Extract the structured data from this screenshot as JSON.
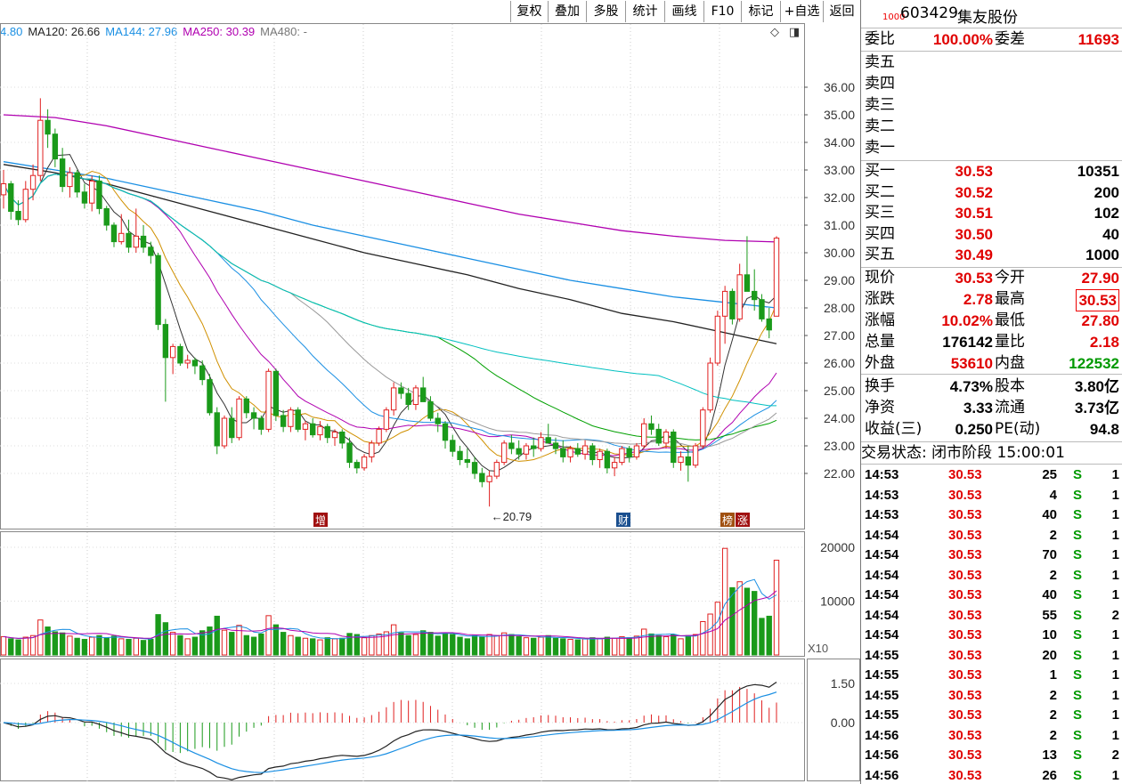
{
  "toolbar": {
    "buttons": [
      "复权",
      "叠加",
      "多股",
      "统计",
      "画线",
      "F10",
      "标记",
      "+自选",
      "返回"
    ]
  },
  "ma_legend": [
    {
      "label": "4.80",
      "color": "#1a8fe3"
    },
    {
      "label": "MA120: 26.66",
      "color": "#222222"
    },
    {
      "label": "MA144: 27.96",
      "color": "#1a8fe3"
    },
    {
      "label": "MA250: 30.39",
      "color": "#b000b0"
    },
    {
      "label": "MA480: -",
      "color": "#777777"
    }
  ],
  "chart_labels": {
    "low_marker": "←20.79",
    "event_tags": [
      {
        "text": "增",
        "color": "#a01010"
      },
      {
        "text": "财",
        "color": "#1a4f8f"
      },
      {
        "text": "榜",
        "color": "#a05010"
      },
      {
        "text": "涨",
        "color": "#a01010"
      }
    ],
    "volume_unit": "X10"
  },
  "chart_data": {
    "type": "candlestick",
    "price_axis": {
      "ticks": [
        "36.00",
        "35.00",
        "34.00",
        "33.00",
        "32.00",
        "31.00",
        "30.00",
        "29.00",
        "28.00",
        "27.00",
        "26.00",
        "25.00",
        "24.00",
        "23.00",
        "22.00"
      ],
      "range": [
        21.0,
        36.5
      ]
    },
    "volume_axis": {
      "ticks": [
        "20000",
        "10000"
      ],
      "range": [
        0,
        22000
      ]
    },
    "macd_axis": {
      "ticks": [
        "1.50",
        "0.00"
      ],
      "range": [
        -2.2,
        1.9
      ]
    },
    "candles": [
      [
        32.1,
        33.0,
        31.6,
        32.5,
        3400
      ],
      [
        32.5,
        32.6,
        31.2,
        31.5,
        3000
      ],
      [
        31.5,
        31.9,
        31.0,
        31.2,
        2800
      ],
      [
        31.2,
        32.6,
        31.1,
        32.3,
        3300
      ],
      [
        32.3,
        33.2,
        31.9,
        32.8,
        3600
      ],
      [
        32.8,
        35.6,
        32.6,
        34.8,
        6500
      ],
      [
        34.8,
        35.2,
        33.8,
        34.3,
        5200
      ],
      [
        34.3,
        34.5,
        33.1,
        33.4,
        4300
      ],
      [
        33.4,
        33.8,
        32.2,
        32.4,
        4100
      ],
      [
        32.4,
        33.1,
        32.0,
        32.9,
        3500
      ],
      [
        32.9,
        33.0,
        32.0,
        32.2,
        3100
      ],
      [
        32.2,
        32.5,
        31.6,
        31.8,
        2900
      ],
      [
        31.8,
        32.8,
        31.5,
        32.6,
        3300
      ],
      [
        32.6,
        32.8,
        31.4,
        31.6,
        3600
      ],
      [
        31.6,
        31.7,
        30.8,
        31.0,
        3200
      ],
      [
        31.0,
        31.1,
        30.2,
        30.4,
        3500
      ],
      [
        30.4,
        31.4,
        30.3,
        30.7,
        3000
      ],
      [
        30.7,
        31.2,
        30.0,
        30.2,
        2900
      ],
      [
        30.2,
        31.6,
        30.0,
        30.6,
        3100
      ],
      [
        30.6,
        31.0,
        30.0,
        30.2,
        2700
      ],
      [
        30.2,
        30.4,
        29.6,
        29.9,
        2900
      ],
      [
        29.9,
        30.0,
        27.2,
        27.4,
        7500
      ],
      [
        27.4,
        27.6,
        24.6,
        26.2,
        6000
      ],
      [
        26.2,
        26.7,
        25.6,
        26.6,
        4200
      ],
      [
        26.6,
        26.7,
        25.9,
        26.0,
        3600
      ],
      [
        26.0,
        26.3,
        25.8,
        26.1,
        3000
      ],
      [
        26.1,
        26.2,
        25.6,
        25.9,
        3300
      ],
      [
        25.9,
        26.1,
        25.2,
        25.4,
        4500
      ],
      [
        25.4,
        25.6,
        24.1,
        24.2,
        5200
      ],
      [
        24.2,
        24.4,
        22.7,
        23.0,
        7200
      ],
      [
        23.0,
        24.1,
        22.9,
        24.0,
        4600
      ],
      [
        24.0,
        24.4,
        23.1,
        23.3,
        4200
      ],
      [
        23.3,
        24.8,
        23.2,
        24.7,
        5500
      ],
      [
        24.7,
        24.8,
        24.0,
        24.2,
        3600
      ],
      [
        24.2,
        24.4,
        23.6,
        24.0,
        3300
      ],
      [
        24.0,
        24.1,
        23.4,
        23.6,
        3900
      ],
      [
        23.6,
        25.8,
        23.5,
        25.7,
        7300
      ],
      [
        25.7,
        25.8,
        23.9,
        24.1,
        5600
      ],
      [
        24.1,
        24.3,
        23.5,
        23.7,
        4200
      ],
      [
        23.7,
        24.4,
        23.5,
        24.3,
        3600
      ],
      [
        24.3,
        24.4,
        23.5,
        23.6,
        3300
      ],
      [
        23.6,
        23.9,
        23.2,
        23.8,
        3100
      ],
      [
        23.8,
        24.0,
        23.3,
        23.4,
        3000
      ],
      [
        23.4,
        23.9,
        23.2,
        23.7,
        2800
      ],
      [
        23.7,
        23.8,
        23.1,
        23.3,
        3200
      ],
      [
        23.3,
        23.6,
        23.0,
        23.5,
        3000
      ],
      [
        23.5,
        23.6,
        22.9,
        23.1,
        3100
      ],
      [
        23.1,
        23.3,
        22.2,
        22.4,
        4000
      ],
      [
        22.4,
        22.5,
        22.0,
        22.2,
        3800
      ],
      [
        22.2,
        22.7,
        22.1,
        22.6,
        3200
      ],
      [
        22.6,
        23.2,
        22.4,
        23.1,
        3600
      ],
      [
        23.1,
        23.7,
        23.0,
        23.6,
        3900
      ],
      [
        23.6,
        24.4,
        23.5,
        24.3,
        4300
      ],
      [
        24.3,
        25.3,
        24.1,
        25.1,
        5600
      ],
      [
        25.1,
        25.3,
        24.7,
        24.9,
        4100
      ],
      [
        24.9,
        25.1,
        24.3,
        24.5,
        3600
      ],
      [
        24.5,
        25.2,
        24.3,
        25.1,
        3800
      ],
      [
        25.1,
        25.5,
        24.6,
        24.6,
        4500
      ],
      [
        24.6,
        24.8,
        23.9,
        24.0,
        4200
      ],
      [
        24.0,
        24.2,
        23.5,
        23.8,
        3500
      ],
      [
        23.8,
        23.9,
        22.9,
        23.2,
        4000
      ],
      [
        23.2,
        23.4,
        22.6,
        22.8,
        3800
      ],
      [
        22.8,
        23.0,
        22.3,
        22.5,
        3300
      ],
      [
        22.5,
        22.9,
        22.2,
        22.4,
        3000
      ],
      [
        22.4,
        22.6,
        21.8,
        22.0,
        3600
      ],
      [
        22.0,
        22.2,
        21.5,
        21.7,
        3400
      ],
      [
        21.7,
        22.1,
        20.8,
        21.9,
        3800
      ],
      [
        21.9,
        22.5,
        21.8,
        22.4,
        3600
      ],
      [
        22.4,
        23.2,
        22.3,
        23.1,
        4100
      ],
      [
        23.1,
        23.4,
        22.7,
        22.9,
        3800
      ],
      [
        22.9,
        23.2,
        22.5,
        22.7,
        3400
      ],
      [
        22.7,
        23.1,
        22.5,
        23.0,
        3200
      ],
      [
        23.0,
        23.3,
        22.6,
        22.9,
        3100
      ],
      [
        22.9,
        23.5,
        22.8,
        23.3,
        3300
      ],
      [
        23.3,
        23.8,
        23.1,
        23.1,
        3600
      ],
      [
        23.1,
        23.3,
        22.7,
        22.9,
        3100
      ],
      [
        22.9,
        23.2,
        22.4,
        22.6,
        3000
      ],
      [
        22.6,
        23.0,
        22.4,
        22.9,
        2900
      ],
      [
        22.9,
        23.1,
        22.6,
        22.7,
        2800
      ],
      [
        22.7,
        23.2,
        22.5,
        23.0,
        3000
      ],
      [
        23.0,
        23.1,
        22.3,
        22.5,
        3200
      ],
      [
        22.5,
        22.9,
        22.2,
        22.8,
        3000
      ],
      [
        22.8,
        22.9,
        22.0,
        22.2,
        3300
      ],
      [
        22.2,
        22.6,
        21.9,
        22.4,
        3100
      ],
      [
        22.4,
        23.0,
        22.3,
        22.9,
        3400
      ],
      [
        22.9,
        23.0,
        22.4,
        22.6,
        3200
      ],
      [
        22.6,
        23.1,
        22.5,
        23.0,
        3500
      ],
      [
        23.0,
        24.0,
        22.9,
        23.8,
        4800
      ],
      [
        23.8,
        24.1,
        23.4,
        23.6,
        3900
      ],
      [
        23.6,
        23.8,
        23.0,
        23.1,
        3600
      ],
      [
        23.1,
        23.6,
        22.9,
        23.5,
        3400
      ],
      [
        23.5,
        23.6,
        22.2,
        22.4,
        3800
      ],
      [
        22.4,
        22.8,
        22.1,
        22.6,
        3000
      ],
      [
        22.6,
        23.0,
        21.7,
        22.3,
        3600
      ],
      [
        22.3,
        23.1,
        22.2,
        23.0,
        3800
      ],
      [
        23.0,
        24.4,
        22.9,
        24.3,
        6200
      ],
      [
        24.3,
        26.2,
        24.2,
        26.0,
        7600
      ],
      [
        26.0,
        27.9,
        25.9,
        27.7,
        9800
      ],
      [
        27.7,
        28.8,
        26.7,
        28.6,
        19800
      ],
      [
        28.6,
        28.7,
        27.4,
        27.6,
        12500
      ],
      [
        27.6,
        29.6,
        27.5,
        29.2,
        13600
      ],
      [
        29.2,
        30.6,
        28.6,
        28.6,
        12400
      ],
      [
        28.6,
        29.4,
        27.9,
        28.3,
        11800
      ],
      [
        28.3,
        28.5,
        27.5,
        27.6,
        6800
      ],
      [
        27.6,
        28.0,
        26.9,
        27.2,
        7200
      ],
      [
        27.7,
        30.6,
        27.7,
        30.53,
        17600
      ]
    ],
    "ma_lines": [
      {
        "name": "MA120",
        "color": "#222222",
        "values": [
          33.2,
          32.9,
          32.5,
          32.0,
          31.5,
          31.0,
          30.5,
          30.0,
          29.6,
          29.2,
          28.7,
          28.3,
          27.8,
          27.5,
          27.1,
          26.7
        ]
      },
      {
        "name": "MA144",
        "color": "#1a8fe3",
        "values": [
          33.3,
          33.0,
          32.7,
          32.3,
          31.9,
          31.5,
          31.0,
          30.6,
          30.2,
          29.8,
          29.4,
          29.0,
          28.7,
          28.4,
          28.2,
          28.0
        ]
      },
      {
        "name": "MA250",
        "color": "#b000b0",
        "values": [
          35.0,
          34.9,
          34.6,
          34.2,
          33.8,
          33.4,
          33.0,
          32.6,
          32.2,
          31.8,
          31.4,
          31.1,
          30.8,
          30.6,
          30.45,
          30.39
        ]
      }
    ],
    "legend_position": "top-left"
  },
  "quote": {
    "code": "603429",
    "name": "集友股份",
    "logo": "1000",
    "weibi_label": "委比",
    "weibi_value": "100.00%",
    "weicha_label": "委差",
    "weicha_value": "11693",
    "sell": [
      {
        "label": "卖五"
      },
      {
        "label": "卖四"
      },
      {
        "label": "卖三"
      },
      {
        "label": "卖二"
      },
      {
        "label": "卖一"
      }
    ],
    "buy": [
      {
        "label": "买一",
        "price": "30.53",
        "vol": "10351"
      },
      {
        "label": "买二",
        "price": "30.52",
        "vol": "200"
      },
      {
        "label": "买三",
        "price": "30.51",
        "vol": "102"
      },
      {
        "label": "买四",
        "price": "30.50",
        "vol": "40"
      },
      {
        "label": "买五",
        "price": "30.49",
        "vol": "1000"
      }
    ],
    "stats": [
      {
        "l1": "现价",
        "v1": "30.53",
        "c1": "red",
        "l2": "今开",
        "v2": "27.90",
        "c2": "red"
      },
      {
        "l1": "涨跌",
        "v1": "2.78",
        "c1": "red",
        "l2": "最高",
        "v2": "30.53",
        "c2": "red"
      },
      {
        "l1": "涨幅",
        "v1": "10.02%",
        "c1": "red",
        "l2": "最低",
        "v2": "27.80",
        "c2": "red"
      },
      {
        "l1": "总量",
        "v1": "176142",
        "c1": "",
        "l2": "量比",
        "v2": "2.18",
        "c2": "red"
      },
      {
        "l1": "外盘",
        "v1": "53610",
        "c1": "red",
        "l2": "内盘",
        "v2": "122532",
        "c2": "green"
      }
    ],
    "stats2": [
      {
        "l1": "换手",
        "v1": "4.73%",
        "l2": "股本",
        "v2": "3.80亿"
      },
      {
        "l1": "净资",
        "v1": "3.33",
        "l2": "流通",
        "v2": "3.73亿"
      },
      {
        "l1": "收益(三)",
        "v1": "0.250",
        "l2": "PE(动)",
        "v2": "94.8"
      }
    ],
    "trade_status": "交易状态: 闭市阶段 15:00:01",
    "ticks": [
      {
        "t": "14:53",
        "p": "30.53",
        "v": "25",
        "s": "S",
        "n": "1"
      },
      {
        "t": "14:53",
        "p": "30.53",
        "v": "4",
        "s": "S",
        "n": "1"
      },
      {
        "t": "14:53",
        "p": "30.53",
        "v": "40",
        "s": "S",
        "n": "1"
      },
      {
        "t": "14:54",
        "p": "30.53",
        "v": "2",
        "s": "S",
        "n": "1"
      },
      {
        "t": "14:54",
        "p": "30.53",
        "v": "70",
        "s": "S",
        "n": "1"
      },
      {
        "t": "14:54",
        "p": "30.53",
        "v": "2",
        "s": "S",
        "n": "1"
      },
      {
        "t": "14:54",
        "p": "30.53",
        "v": "40",
        "s": "S",
        "n": "1"
      },
      {
        "t": "14:54",
        "p": "30.53",
        "v": "55",
        "s": "S",
        "n": "2"
      },
      {
        "t": "14:54",
        "p": "30.53",
        "v": "10",
        "s": "S",
        "n": "1"
      },
      {
        "t": "14:55",
        "p": "30.53",
        "v": "20",
        "s": "S",
        "n": "1"
      },
      {
        "t": "14:55",
        "p": "30.53",
        "v": "1",
        "s": "S",
        "n": "1"
      },
      {
        "t": "14:55",
        "p": "30.53",
        "v": "2",
        "s": "S",
        "n": "1"
      },
      {
        "t": "14:55",
        "p": "30.53",
        "v": "2",
        "s": "S",
        "n": "1"
      },
      {
        "t": "14:56",
        "p": "30.53",
        "v": "2",
        "s": "S",
        "n": "1"
      },
      {
        "t": "14:56",
        "p": "30.53",
        "v": "13",
        "s": "S",
        "n": "2"
      },
      {
        "t": "14:56",
        "p": "30.53",
        "v": "26",
        "s": "S",
        "n": "1"
      }
    ]
  }
}
